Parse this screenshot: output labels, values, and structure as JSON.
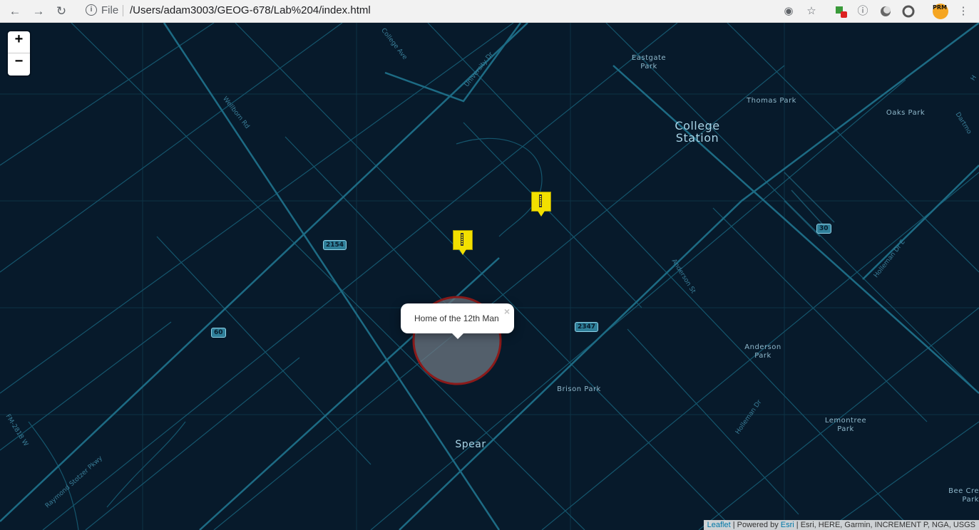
{
  "browser": {
    "back_glyph": "←",
    "forward_glyph": "→",
    "reload_glyph": "↻",
    "file_label": "File",
    "url": "/Users/adam3003/GEOG-678/Lab%204/index.html",
    "toolbar_icons": [
      "location-icon",
      "star-icon",
      "extension-icon",
      "info-icon",
      "circle-icon",
      "search-icon",
      "profile-avatar",
      "menu-icon"
    ],
    "avatar_text": "PRM"
  },
  "map": {
    "zoom_in": "+",
    "zoom_out": "−",
    "place_labels": {
      "college_station": "College\nStation",
      "spear": "Spear",
      "eastgate_park": "Eastgate\nPark",
      "thomas_park": "Thomas Park",
      "oaks_park": "Oaks Park",
      "anderson_park": "Anderson\nPark",
      "brison_park": "Brison Park",
      "lemontree_park": "Lemontree\nPark",
      "bee_creek": "Bee Cre\nPark"
    },
    "road_labels": {
      "college_ave": "College Ave",
      "university_dr": "University Dr",
      "wellborn_rd": "Wellborn Rd",
      "anderson_st": "Anderson St",
      "holleman_dr_e": "Holleman Dr E",
      "holleman_dr": "Holleman Dr",
      "fm_2818": "FM-2818 W",
      "raymond_stotzer": "Raymond Stotzer Pkwy",
      "dartmouth": "Dartmo",
      "h_edge": "H"
    },
    "shields": {
      "s2154": "2154",
      "s60": "60",
      "s30": "30",
      "s2347": "2347"
    },
    "markers": [
      "stadium-marker",
      "stadium-marker"
    ],
    "popup_text": "Home of the 12th Man",
    "popup_close": "×",
    "attribution": {
      "leaflet": "Leaflet",
      "powered_by": " | Powered by ",
      "esri": "Esri",
      "sources": " | Esri, HERE, Garmin, INCREMENT P, NGA, USGS"
    },
    "colors": {
      "background": "#071a2b",
      "roads": "#1d6b84",
      "marker": "#f2e000",
      "circle_stroke": "#8b1a1a",
      "circle_fill": "#6d7782"
    }
  }
}
